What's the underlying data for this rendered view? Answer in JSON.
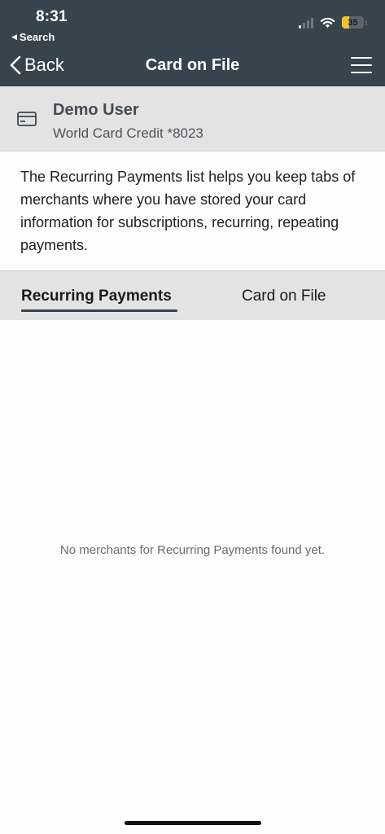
{
  "status_bar": {
    "time": "8:31",
    "back_app": "Search",
    "battery_level": "35",
    "battery_color": "#f4c430"
  },
  "nav": {
    "back_label": "Back",
    "title": "Card on File",
    "menu_icon": "hamburger-menu-icon",
    "background": "#37434d"
  },
  "card": {
    "icon": "credit-card-icon",
    "user_name": "Demo User",
    "card_label": "World Card Credit *8023"
  },
  "description": "The Recurring Payments list helps you keep tabs of merchants where you have stored your card information for subscriptions, recurring, repeating payments.",
  "tabs": [
    {
      "label": "Recurring Payments",
      "active": true
    },
    {
      "label": "Card on File",
      "active": false
    }
  ],
  "empty_state": "No merchants for Recurring Payments found yet."
}
